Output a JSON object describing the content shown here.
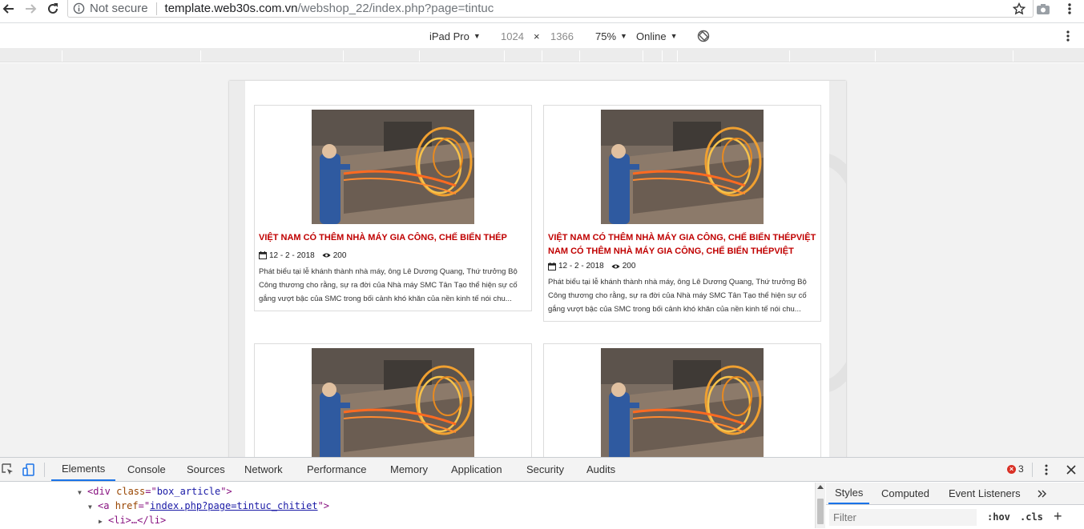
{
  "browser": {
    "security_label": "Not secure",
    "url_host": "template.web30s.com.vn",
    "url_path": "/webshop_22/index.php?page=tintuc"
  },
  "device_toolbar": {
    "device": "iPad Pro",
    "width": "1024",
    "times": "×",
    "height": "1366",
    "zoom": "75%",
    "network": "Online"
  },
  "articles": [
    {
      "title": "VIỆT NAM CÓ THÊM NHÀ MÁY GIA CÔNG, CHẾ BIẾN THÉP",
      "date": "12 - 2 - 2018",
      "views": "200",
      "excerpt": "Phát biểu tại lễ khánh thành nhà máy, ông Lê Dương Quang, Thứ trưởng Bộ Công thương cho rằng, sự ra đời của Nhà máy SMC Tân Tạo thể hiện sự cố gắng vượt bậc của SMC trong bối cảnh khó khăn của nền kinh tế nói chu..."
    },
    {
      "title": "VIỆT NAM CÓ THÊM NHÀ MÁY GIA CÔNG, CHẾ BIẾN THÉPVIỆT NAM CÓ THÊM NHÀ MÁY GIA CÔNG, CHẾ BIẾN THÉPVIỆT NAM...",
      "date": "12 - 2 - 2018",
      "views": "200",
      "excerpt": "Phát biểu tại lễ khánh thành nhà máy, ông Lê Dương Quang, Thứ trưởng Bộ Công thương cho rằng, sự ra đời của Nhà máy SMC Tân Tạo thể hiện sự cố gắng vượt bậc của SMC trong bối cảnh khó khăn của nền kinh tế nói chu..."
    }
  ],
  "devtools": {
    "tabs": [
      "Elements",
      "Console",
      "Sources",
      "Network",
      "Performance",
      "Memory",
      "Application",
      "Security",
      "Audits"
    ],
    "active_tab": "Elements",
    "error_count": "3",
    "dom_lines": [
      {
        "tag_open": "<div ",
        "attr": "class",
        "eq": "=\"",
        "value": "box_article",
        "tag_close": "\">"
      },
      {
        "tag_open": "<a ",
        "attr": "href",
        "eq": "=\"",
        "value": "index.php?page=tintuc_chitiet",
        "tag_close": "\">"
      },
      {
        "text": "<li>…</li>"
      }
    ],
    "side_tabs": [
      "Styles",
      "Computed",
      "Event Listeners"
    ],
    "active_side_tab": "Styles",
    "filter_placeholder": "Filter",
    "hov": ":hov",
    "cls": ".cls",
    "plus": "+"
  },
  "colors": {
    "title_red": "#c00000",
    "active_tab_blue": "#1a73e8",
    "error_red": "#d93025"
  },
  "icons": [
    "back-arrow-icon",
    "forward-arrow-icon",
    "reload-icon",
    "info-icon",
    "star-icon",
    "camera-icon",
    "kebab-menu-icon",
    "rotate-icon",
    "calendar-icon",
    "eye-icon",
    "inspect-icon",
    "device-toggle-icon",
    "close-icon",
    "chevron-double-right-icon"
  ]
}
